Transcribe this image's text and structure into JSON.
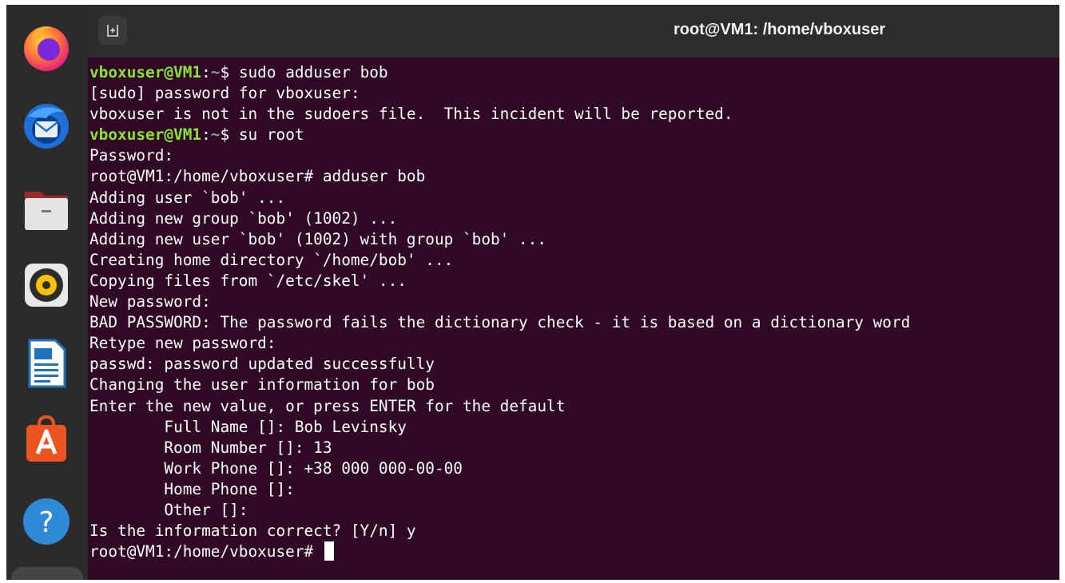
{
  "window": {
    "title": "root@VM1: /home/vboxuser"
  },
  "dock": {
    "apps": [
      {
        "name": "firefox-icon"
      },
      {
        "name": "thunderbird-icon"
      },
      {
        "name": "files-icon"
      },
      {
        "name": "rhythmbox-icon"
      },
      {
        "name": "libreoffice-writer-icon"
      },
      {
        "name": "app-center-icon"
      },
      {
        "name": "help-icon"
      }
    ]
  },
  "colors": {
    "terminal_background": "#300a24",
    "prompt_user": "#8ae234",
    "prompt_path": "#729fcf",
    "text": "#ffffff"
  },
  "terminal": {
    "lines": [
      {
        "user": "vboxuser@VM1",
        "colon": ":",
        "path": "~",
        "rest": "$ sudo adduser bob"
      },
      {
        "text": "[sudo] password for vboxuser:"
      },
      {
        "text": "vboxuser is not in the sudoers file.  This incident will be reported."
      },
      {
        "user": "vboxuser@VM1",
        "colon": ":",
        "path": "~",
        "rest": "$ su root"
      },
      {
        "text": "Password:"
      },
      {
        "text": "root@VM1:/home/vboxuser# adduser bob"
      },
      {
        "text": "Adding user `bob' ..."
      },
      {
        "text": "Adding new group `bob' (1002) ..."
      },
      {
        "text": "Adding new user `bob' (1002) with group `bob' ..."
      },
      {
        "text": "Creating home directory `/home/bob' ..."
      },
      {
        "text": "Copying files from `/etc/skel' ..."
      },
      {
        "text": "New password:"
      },
      {
        "text": "BAD PASSWORD: The password fails the dictionary check - it is based on a dictionary word"
      },
      {
        "text": "Retype new password:"
      },
      {
        "text": "passwd: password updated successfully"
      },
      {
        "text": "Changing the user information for bob"
      },
      {
        "text": "Enter the new value, or press ENTER for the default"
      },
      {
        "text": "        Full Name []: Bob Levinsky"
      },
      {
        "text": "        Room Number []: 13"
      },
      {
        "text": "        Work Phone []: +38 000 000-00-00"
      },
      {
        "text": "        Home Phone []:"
      },
      {
        "text": "        Other []:"
      },
      {
        "text": "Is the information correct? [Y/n] y"
      },
      {
        "text": "root@VM1:/home/vboxuser# ",
        "cursor": true
      }
    ]
  }
}
